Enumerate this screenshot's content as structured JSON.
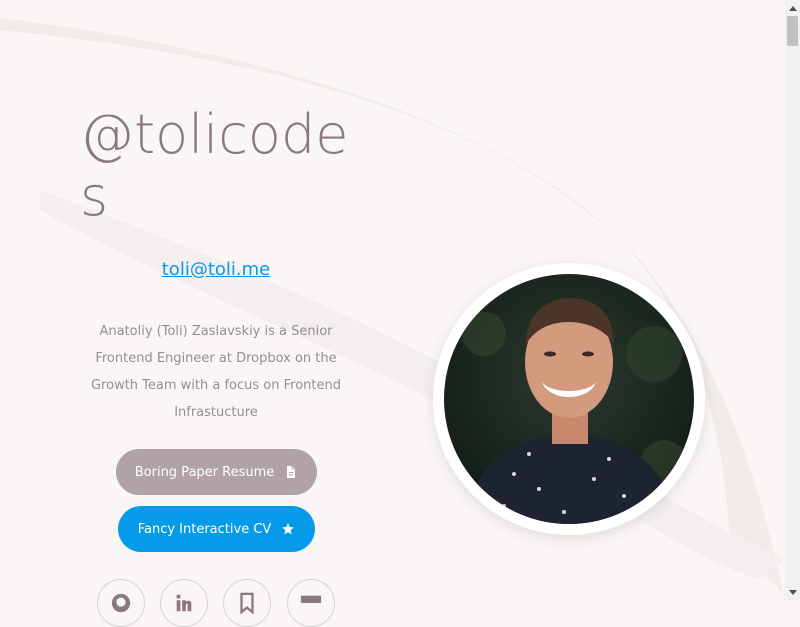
{
  "profile": {
    "handle": "@tolicodes",
    "email": "toli@toli.me",
    "bio": "Anatoliy (Toli) Zaslavskiy is a Senior Frontend Engineer at Dropbox on the Growth Team with a focus on Frontend Infrastucture"
  },
  "buttons": {
    "resume_label": "Boring Paper Resume",
    "resume_icon": "document-icon",
    "cv_label": "Fancy Interactive CV",
    "cv_icon": "star-icon"
  },
  "social": [
    "github-icon",
    "linkedin-icon",
    "bookmark-icon",
    "medium-icon"
  ],
  "colors": {
    "background": "#faf6f5",
    "handle_text": "#8a787d",
    "link": "#069be8",
    "resume_button": "#b0a2a5",
    "cv_button": "#069be8"
  }
}
